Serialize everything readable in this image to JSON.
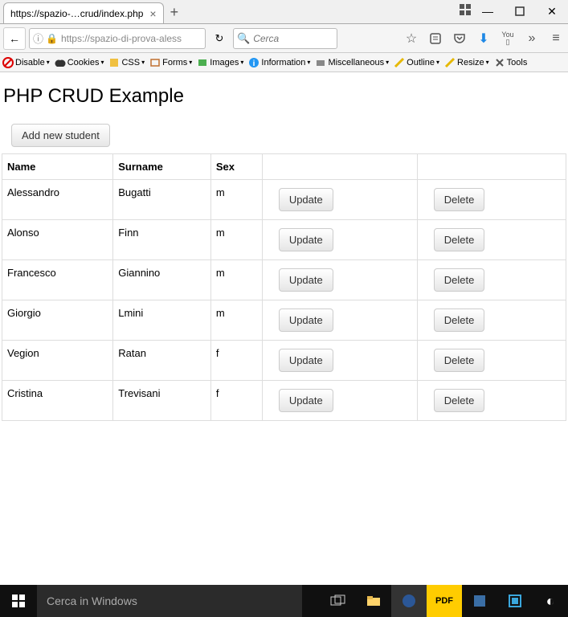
{
  "window": {
    "tab_title": "https://spazio-…crud/index.php",
    "new_tab": "+"
  },
  "nav": {
    "url": "https://spazio-di-prova-aless",
    "search_placeholder": "Cerca"
  },
  "devbar": {
    "items": [
      "Disable",
      "Cookies",
      "CSS",
      "Forms",
      "Images",
      "Information",
      "Miscellaneous",
      "Outline",
      "Resize",
      "Tools"
    ]
  },
  "page": {
    "title": "PHP CRUD Example",
    "add_button": "Add new student",
    "headers": {
      "name": "Name",
      "surname": "Surname",
      "sex": "Sex"
    },
    "update_label": "Update",
    "delete_label": "Delete",
    "rows": [
      {
        "name": "Alessandro",
        "surname": "Bugatti",
        "sex": "m"
      },
      {
        "name": "Alonso",
        "surname": "Finn",
        "sex": "m"
      },
      {
        "name": "Francesco",
        "surname": "Giannino",
        "sex": "m"
      },
      {
        "name": "Giorgio",
        "surname": "Lmini",
        "sex": "m"
      },
      {
        "name": "Vegion",
        "surname": "Ratan",
        "sex": "f"
      },
      {
        "name": "Cristina",
        "surname": "Trevisani",
        "sex": "f"
      }
    ]
  },
  "taskbar": {
    "search_placeholder": "Cerca in Windows"
  }
}
